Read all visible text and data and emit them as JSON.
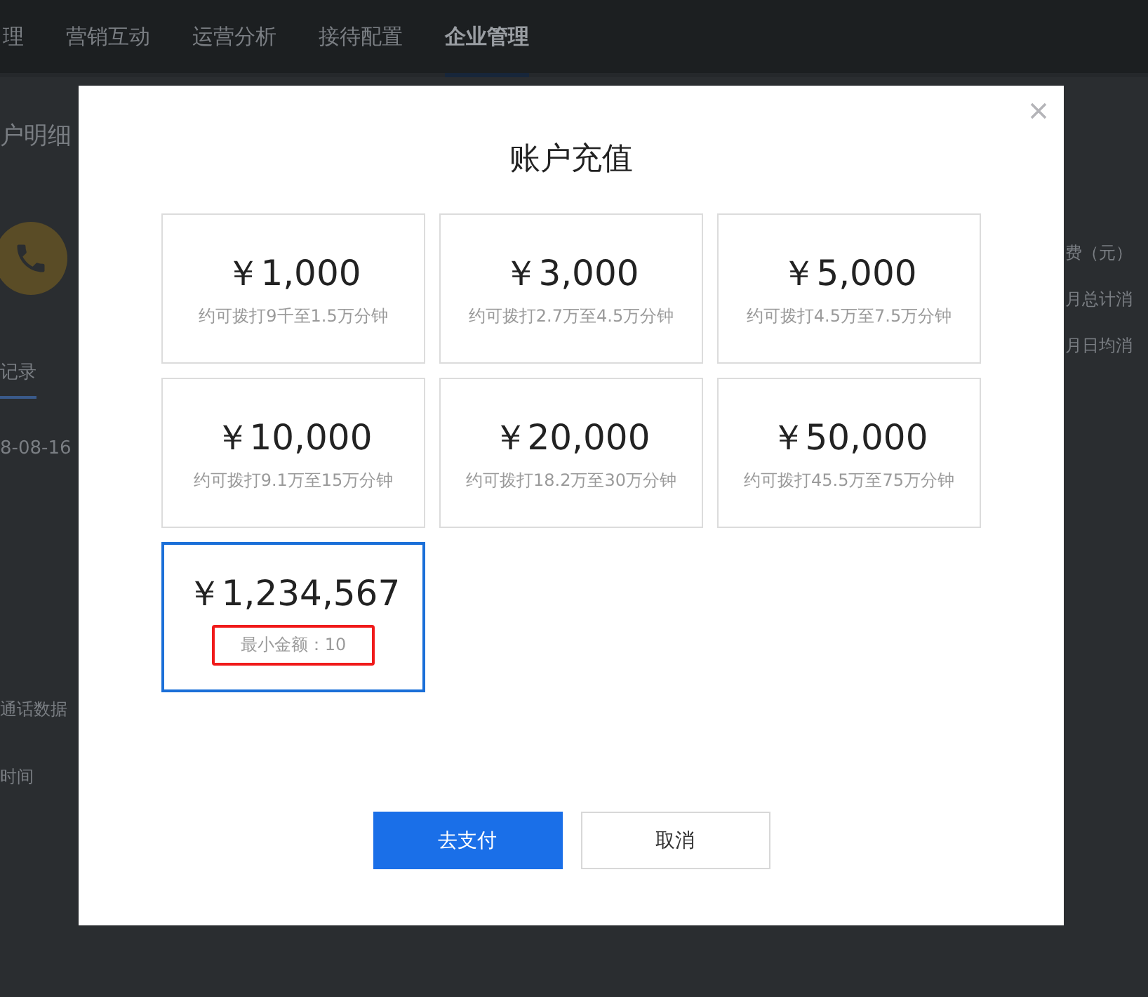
{
  "nav": {
    "tabs": [
      {
        "label": "理",
        "selected": false
      },
      {
        "label": "营销互动",
        "selected": false
      },
      {
        "label": "运营分析",
        "selected": false
      },
      {
        "label": "接待配置",
        "selected": false
      },
      {
        "label": "企业管理",
        "selected": true
      }
    ]
  },
  "page": {
    "title": "户明细",
    "right_lines": [
      "费（元）",
      "月总计消",
      "月日均消"
    ],
    "tab": "记录",
    "date": "8-08-16",
    "notice": "通话数据",
    "time_label": "时间"
  },
  "dialog": {
    "title": "账户充值",
    "options": [
      {
        "kind": "preset",
        "amount": "￥1,000",
        "note": "约可拨打9千至1.5万分钟",
        "selected": false
      },
      {
        "kind": "preset",
        "amount": "￥3,000",
        "note": "约可拨打2.7万至4.5万分钟",
        "selected": false
      },
      {
        "kind": "preset",
        "amount": "￥5,000",
        "note": "约可拨打4.5万至7.5万分钟",
        "selected": false
      },
      {
        "kind": "preset",
        "amount": "￥10,000",
        "note": "约可拨打9.1万至15万分钟",
        "selected": false
      },
      {
        "kind": "preset",
        "amount": "￥20,000",
        "note": "约可拨打18.2万至30万分钟",
        "selected": false
      },
      {
        "kind": "preset",
        "amount": "￥50,000",
        "note": "约可拨打45.5万至75万分钟",
        "selected": false
      },
      {
        "kind": "custom",
        "amount": "￥1,234,567",
        "note": "最小金额：10",
        "selected": true
      }
    ],
    "buttons": [
      {
        "kind": "primary",
        "label": "去支付"
      },
      {
        "kind": "secondary",
        "label": "取消"
      }
    ]
  }
}
